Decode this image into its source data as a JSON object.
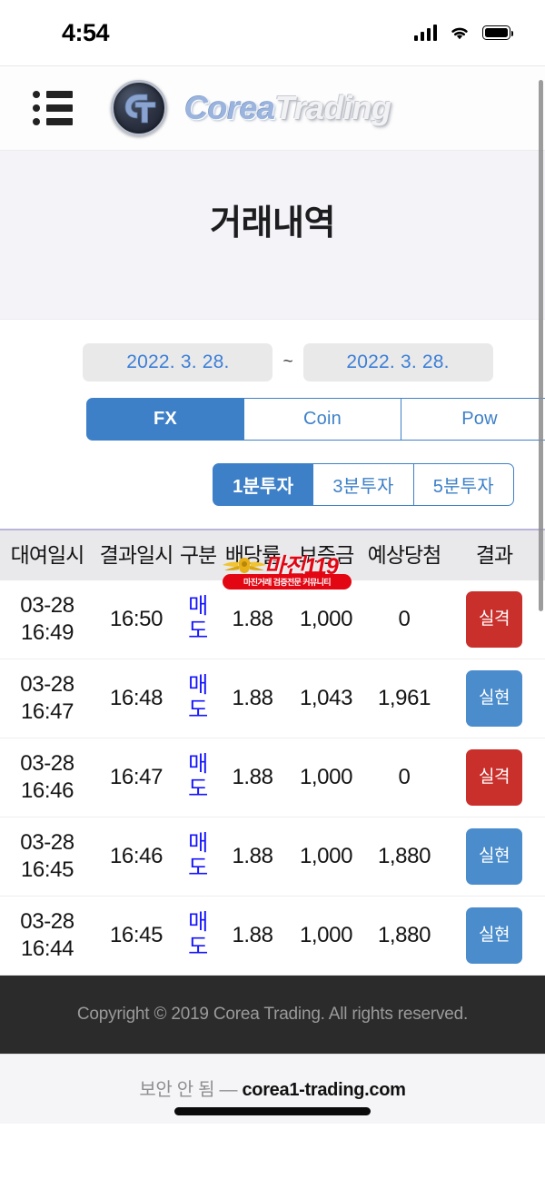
{
  "status_bar": {
    "time": "4:54",
    "signal_icon": "cellular-signal-icon",
    "wifi_icon": "wifi-icon",
    "battery_icon": "battery-icon"
  },
  "header": {
    "menu_icon": "list-menu-icon",
    "logo_mark": "ct-monogram-logo",
    "brand_part1": "Corea",
    "brand_part2": "Trading"
  },
  "page": {
    "title": "거래내역"
  },
  "filters": {
    "date_from": "2022. 3. 28.",
    "date_separator": "~",
    "date_to": "2022. 3. 28.",
    "market_tabs": [
      {
        "label": "FX",
        "active": true
      },
      {
        "label": "Coin",
        "active": false
      },
      {
        "label": "Pow",
        "active": false
      }
    ],
    "interval_tabs": [
      {
        "label": "1분투자",
        "active": true
      },
      {
        "label": "3분투자",
        "active": false
      },
      {
        "label": "5분투자",
        "active": false
      }
    ]
  },
  "table": {
    "headers": [
      "대여일시",
      "결과일시",
      "구분",
      "배당률",
      "보증금",
      "예상당첨",
      "결과"
    ],
    "rows": [
      {
        "lend_date": "03-28",
        "lend_time": "16:49",
        "result_time": "16:50",
        "gubun_1": "매",
        "gubun_2": "도",
        "rate": "1.88",
        "deposit": "1,000",
        "expected": "0",
        "result_1": "실",
        "result_2": "격",
        "result_type": "fail"
      },
      {
        "lend_date": "03-28",
        "lend_time": "16:47",
        "result_time": "16:48",
        "gubun_1": "매",
        "gubun_2": "도",
        "rate": "1.88",
        "deposit": "1,043",
        "expected": "1,961",
        "result_1": "실",
        "result_2": "현",
        "result_type": "win"
      },
      {
        "lend_date": "03-28",
        "lend_time": "16:46",
        "result_time": "16:47",
        "gubun_1": "매",
        "gubun_2": "도",
        "rate": "1.88",
        "deposit": "1,000",
        "expected": "0",
        "result_1": "실",
        "result_2": "격",
        "result_type": "fail"
      },
      {
        "lend_date": "03-28",
        "lend_time": "16:45",
        "result_time": "16:46",
        "gubun_1": "매",
        "gubun_2": "도",
        "rate": "1.88",
        "deposit": "1,000",
        "expected": "1,880",
        "result_1": "실",
        "result_2": "현",
        "result_type": "win"
      },
      {
        "lend_date": "03-28",
        "lend_time": "16:44",
        "result_time": "16:45",
        "gubun_1": "매",
        "gubun_2": "도",
        "rate": "1.88",
        "deposit": "1,000",
        "expected": "1,880",
        "result_1": "실",
        "result_2": "현",
        "result_type": "win"
      }
    ]
  },
  "watermark": {
    "title": "마진119",
    "subtitle": "마진거래 검증전문 커뮤니티",
    "emblem_icon": "eagle-emblem-icon"
  },
  "footer": {
    "copyright": "Copyright © 2019 Corea Trading. All rights reserved."
  },
  "browser_bar": {
    "insecure_label": "보안 안 됨 —",
    "host": "corea1-trading.com"
  },
  "colors": {
    "accent_blue": "#3e80c8",
    "fail_red": "#c9302c",
    "win_blue": "#4a8ccc",
    "gubun_blue": "#1414ff",
    "watermark_red": "#e30613",
    "footer_bg": "#2b2b2b",
    "title_band_bg": "#f3f3f8",
    "table_head_bg": "#e9e9eb"
  }
}
